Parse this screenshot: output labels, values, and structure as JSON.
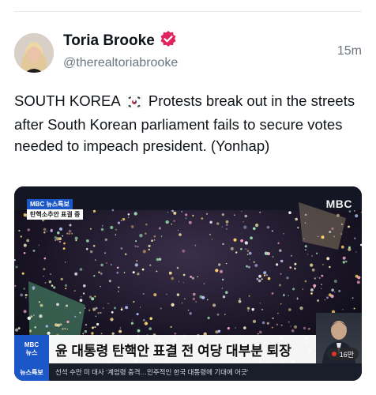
{
  "author": {
    "name": "Toria Brooke",
    "handle": "@therealtoriabrooke",
    "time": "15m"
  },
  "post": {
    "text_before_flag": "SOUTH KOREA",
    "text_after_flag": "Protests break out in the streets after South Korean parliament fails to secure votes needed to impeach president. (Yonhap)"
  },
  "media": {
    "broadcaster_logo": "MBC",
    "top_badge_line1": "MBC 뉴스특보",
    "top_badge_line2": "탄핵소추안 표결 중",
    "lower_badge_line1": "MBC",
    "lower_badge_line2": "뉴스",
    "headline": "윤 대통령 탄핵안 표결 전 여당 대부분 퇴장",
    "ticker_label": "뉴스특보",
    "ticker_text": "선석 수만 미 대사 ‘계엄령 충격…민주적인 한국 대통령에 기대에 어긋’",
    "live_count": "16만"
  },
  "colors": {
    "verified": "#e0245e",
    "mbc_blue": "#1c57c7"
  }
}
